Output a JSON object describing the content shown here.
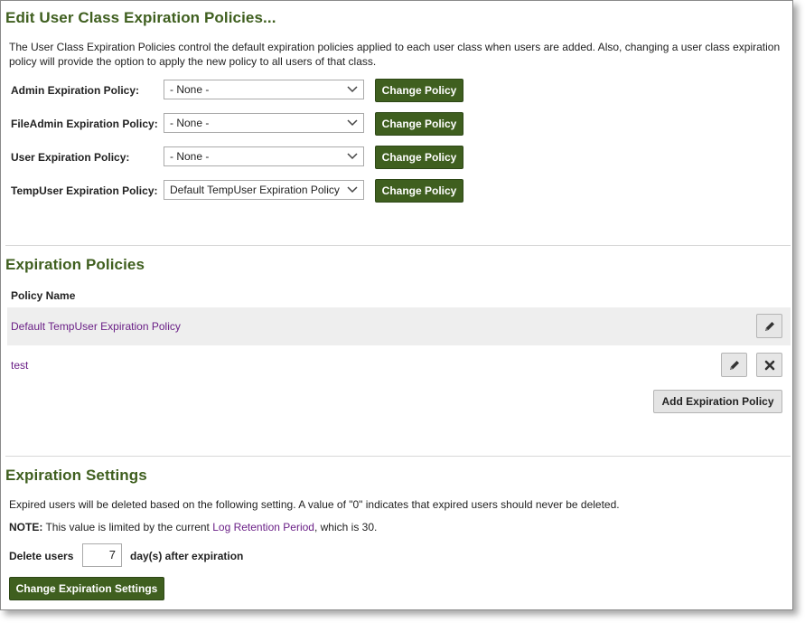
{
  "section1": {
    "title": "Edit User Class Expiration Policies...",
    "intro": "The User Class Expiration Policies control the default expiration policies applied to each user class when users are added. Also, changing a user class expiration policy will provide the option to apply the new policy to all users of that class.",
    "rows": [
      {
        "label": "Admin Expiration Policy:",
        "value": "- None -",
        "button": "Change Policy"
      },
      {
        "label": "FileAdmin Expiration Policy:",
        "value": "- None -",
        "button": "Change Policy"
      },
      {
        "label": "User Expiration Policy:",
        "value": "- None -",
        "button": "Change Policy"
      },
      {
        "label": "TempUser Expiration Policy:",
        "value": "Default TempUser Expiration Policy",
        "button": "Change Policy"
      }
    ]
  },
  "section2": {
    "title": "Expiration Policies",
    "column_header": "Policy Name",
    "policies": [
      {
        "name": "Default TempUser Expiration Policy"
      },
      {
        "name": "test"
      }
    ],
    "add_button": "Add Expiration Policy"
  },
  "section3": {
    "title": "Expiration Settings",
    "description": "Expired users will be deleted based on the following setting. A value of \"0\" indicates that expired users should never be deleted.",
    "note_label": "NOTE:",
    "note_text_before": "This value is limited by the current",
    "note_link": "Log Retention Period",
    "note_text_after": ", which is 30.",
    "delete_label": "Delete users",
    "delete_value": "7",
    "delete_suffix": "day(s) after expiration",
    "save_button": "Change Expiration Settings"
  },
  "colors": {
    "heading": "#3f5f1f",
    "primary_button": "#3f5f1f",
    "link": "#6a1f86",
    "row_shade": "#eeeeee"
  }
}
